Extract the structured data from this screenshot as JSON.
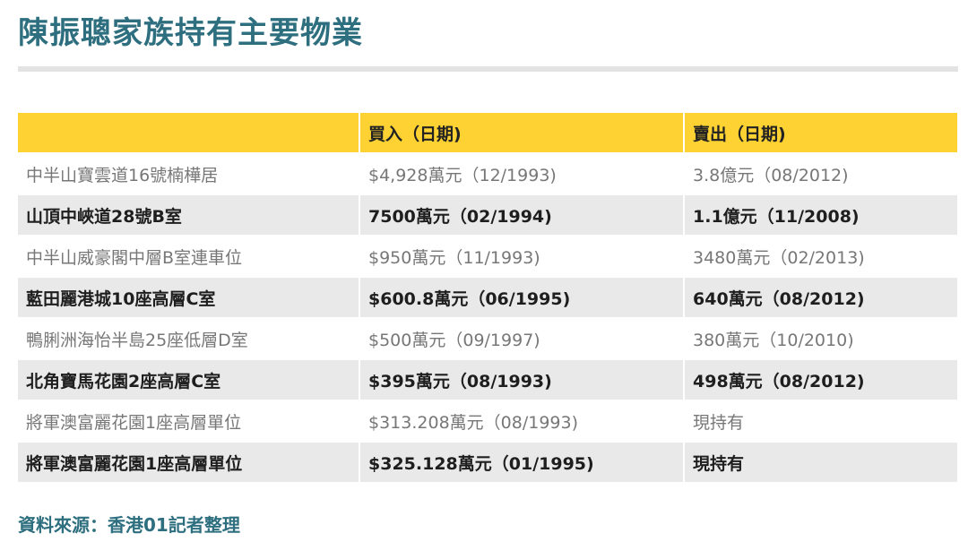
{
  "title": "陳振聰家族持有主要物業",
  "chart_data": {
    "type": "table",
    "columns": [
      "",
      "買入（日期)",
      "賣出（日期)"
    ],
    "rows": [
      [
        "中半山寶雲道16號楠樺居",
        "$4,928萬元（12/1993)",
        "3.8億元（08/2012)"
      ],
      [
        "山頂中峽道28號B室",
        "7500萬元（02/1994)",
        "1.1億元（11/2008)"
      ],
      [
        "中半山威豪閣中層B室連車位",
        "$950萬元（11/1993)",
        "3480萬元（02/2013)"
      ],
      [
        "藍田麗港城10座高層C室",
        "$600.8萬元（06/1995)",
        "640萬元（08/2012)"
      ],
      [
        "鴨脷洲海怡半島25座低層D室",
        "$500萬元（09/1997)",
        "380萬元（10/2010)"
      ],
      [
        "北角寶馬花園2座高層C室",
        "$395萬元（08/1993)",
        "498萬元（08/2012)"
      ],
      [
        "將軍澳富麗花園1座高層單位",
        "$313.208萬元（08/1993)",
        "現持有"
      ],
      [
        "將軍澳富麗花園1座高層單位",
        "$325.128萬元（01/1995)",
        "現持有"
      ]
    ]
  },
  "source": "資料來源：香港01記者整理",
  "colors": {
    "title": "#2d6e7f",
    "header_bg": "#fdd232",
    "stripe_bg": "#e9e9e9",
    "rule": "#e3e3e3"
  }
}
